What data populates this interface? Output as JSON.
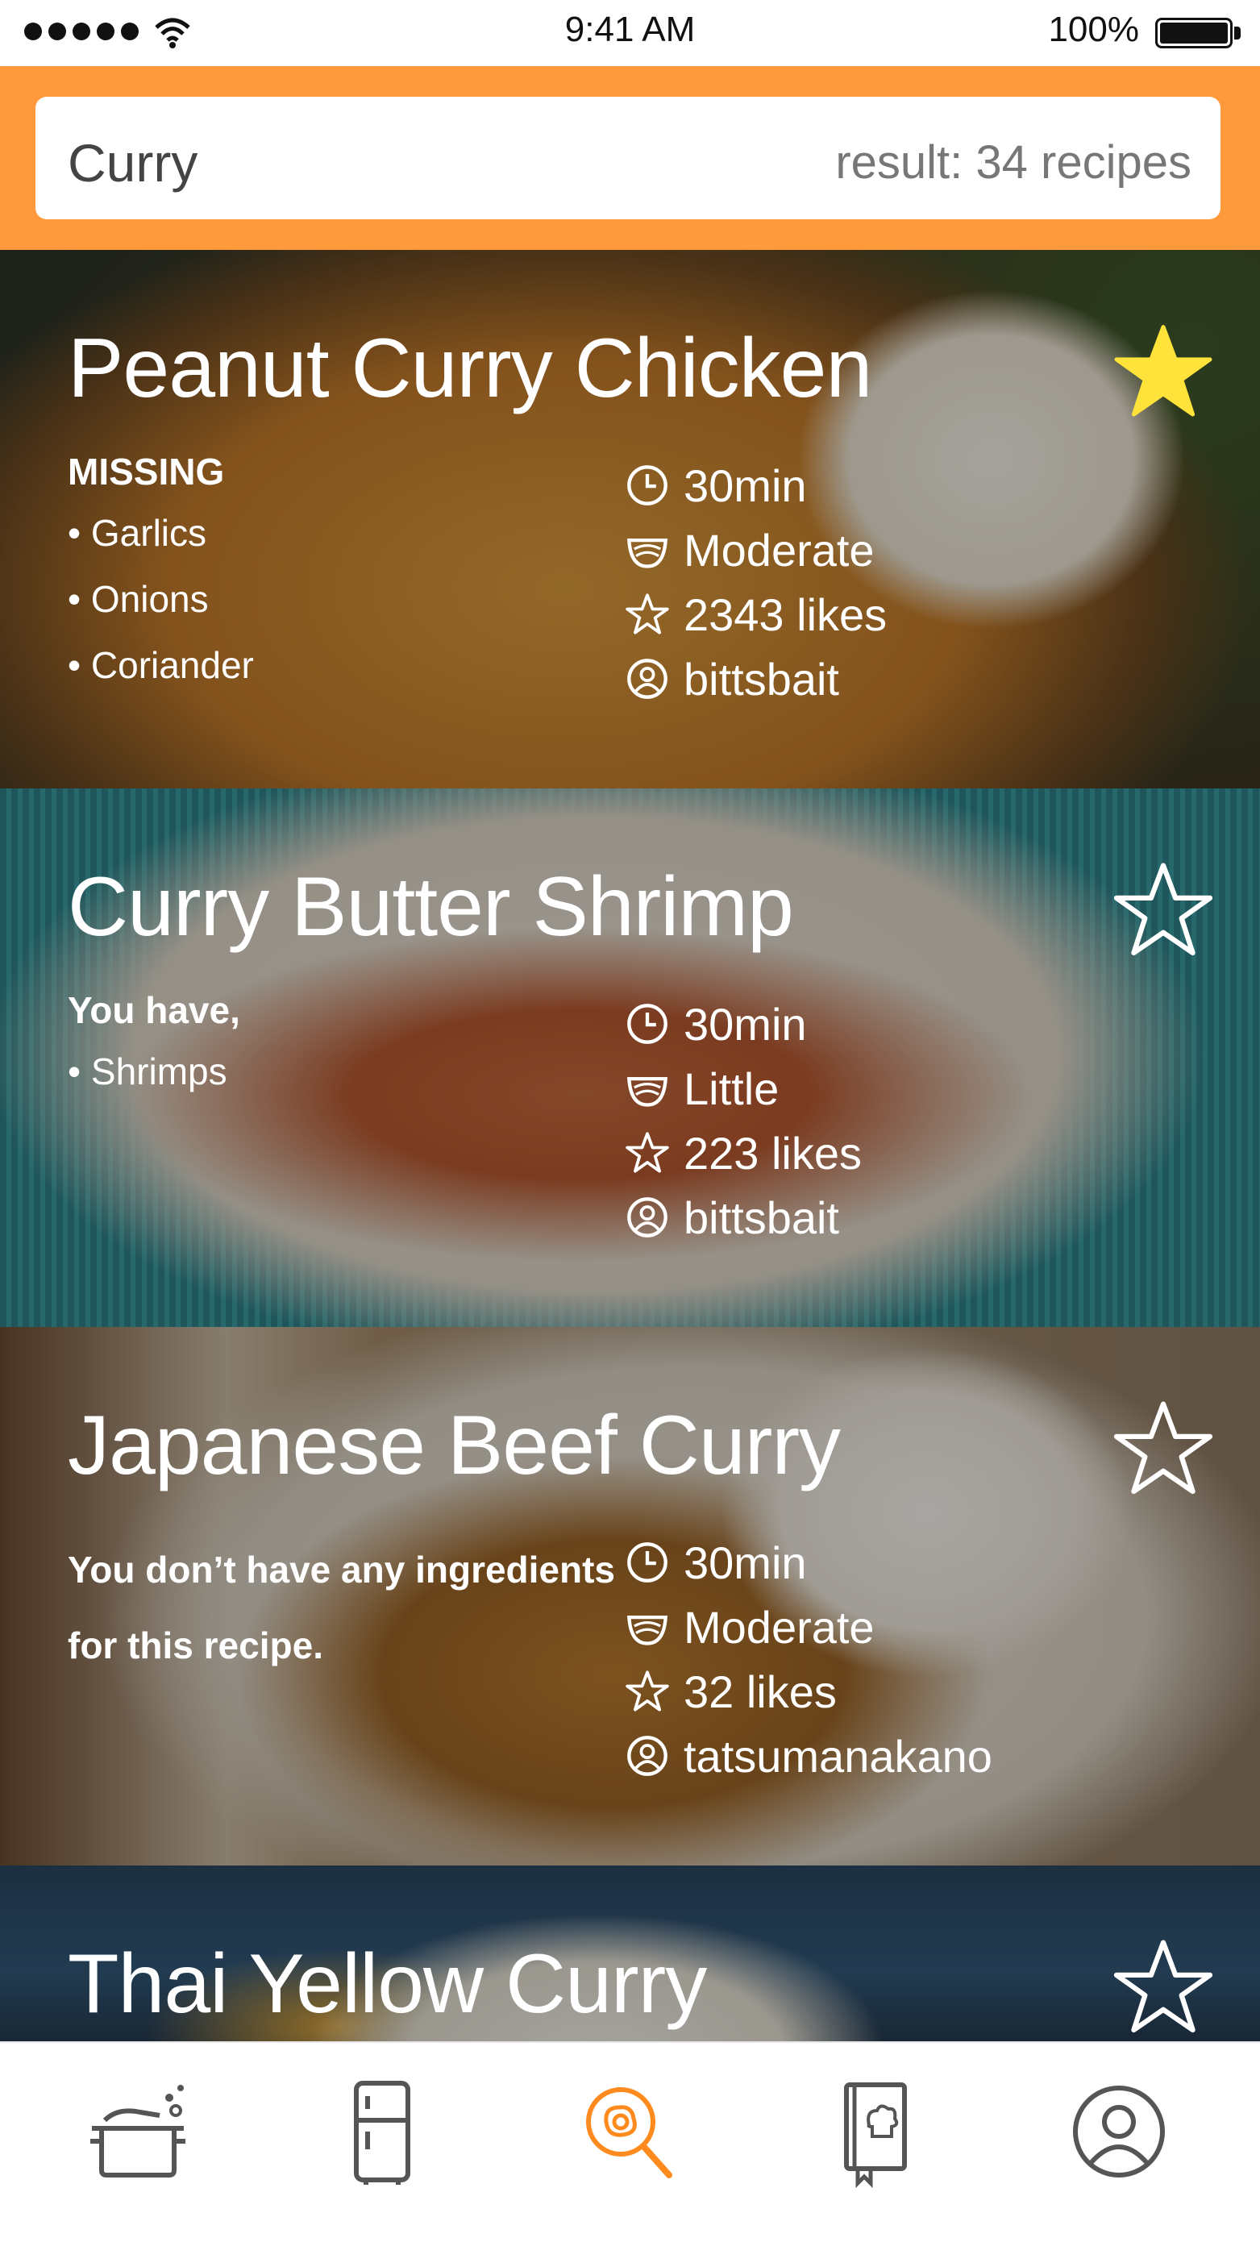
{
  "status_bar": {
    "time": "9:41 AM",
    "battery": "100%"
  },
  "search": {
    "query": "Curry",
    "result": "result: 34 recipes"
  },
  "recipes": [
    {
      "title": "Peanut Curry Chicken",
      "favorited": true,
      "note_heading": "MISSING",
      "note_items": [
        "• Garlics",
        "• Onions",
        "• Coriander"
      ],
      "time": "30min",
      "difficulty": "Moderate",
      "likes": "2343 likes",
      "author": "bittsbait"
    },
    {
      "title": "Curry Butter Shrimp",
      "favorited": false,
      "note_heading": "You have,",
      "note_items": [
        "• Shrimps"
      ],
      "time": "30min",
      "difficulty": "Little",
      "likes": "223 likes",
      "author": "bittsbait"
    },
    {
      "title": "Japanese Beef Curry",
      "favorited": false,
      "note_text": "You don’t have any ingredients for this recipe.",
      "time": "30min",
      "difficulty": "Moderate",
      "likes": "32 likes",
      "author": "tatsumanakano"
    },
    {
      "title": "Thai Yellow Curry",
      "favorited": false
    }
  ],
  "bottom_nav": [
    {
      "icon": "cooking-pot-icon",
      "active": false
    },
    {
      "icon": "fridge-icon",
      "active": false
    },
    {
      "icon": "search-pan-icon",
      "active": true
    },
    {
      "icon": "recipe-book-icon",
      "active": false
    },
    {
      "icon": "profile-icon",
      "active": false
    }
  ],
  "colors": {
    "accent": "#ff9a3c",
    "favorite_star": "#ffe23a",
    "nav_icon": "#555555",
    "nav_active": "#ff8a1e"
  }
}
